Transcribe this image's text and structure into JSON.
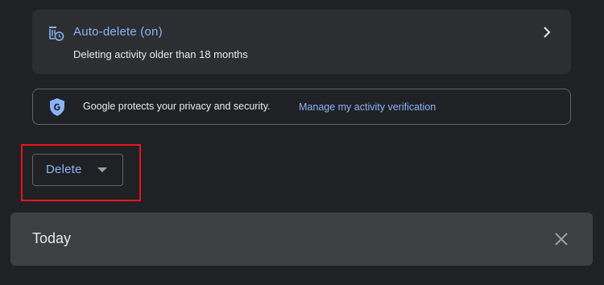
{
  "autodelete": {
    "title": "Auto-delete (on)",
    "subtitle": "Deleting activity older than 18 months",
    "icon": "auto-delete-icon"
  },
  "privacy": {
    "text": "Google protects your privacy and security.",
    "link": "Manage my activity verification",
    "icon": "shield-g-icon"
  },
  "delete_button": {
    "label": "Delete",
    "icon": "caret-down-icon"
  },
  "today": {
    "label": "Today",
    "icon": "close-icon"
  },
  "colors": {
    "background": "#202124",
    "card": "#2d2e31",
    "accent": "#8ab4f8",
    "text": "#e8eaed",
    "border": "#5f6368",
    "highlight": "#e8141b",
    "today_bar": "#3c4043"
  }
}
